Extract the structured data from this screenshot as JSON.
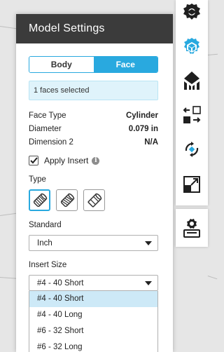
{
  "panel": {
    "title": "Model Settings",
    "segments": [
      {
        "label": "Body",
        "active": false
      },
      {
        "label": "Face",
        "active": true
      }
    ],
    "selection_text": "1 faces selected",
    "properties": [
      {
        "name": "Face Type",
        "value": "Cylinder"
      },
      {
        "name": "Diameter",
        "value": "0.079 in"
      },
      {
        "name": "Dimension 2",
        "value": "N/A"
      }
    ],
    "apply_insert": {
      "label": "Apply Insert",
      "checked": true
    },
    "type_label": "Type",
    "standard_label": "Standard",
    "standard_value": "Inch",
    "insert_size_label": "Insert Size",
    "insert_size_value": "#4 - 40 Short",
    "insert_size_options": [
      "#4 - 40 Short",
      "#4 - 40 Long",
      "#6 - 32 Short",
      "#6 - 32 Long"
    ]
  },
  "toolbar": {
    "icons": [
      "settings-gear-icon",
      "model-settings-cube-icon",
      "supports-icon",
      "arrange-icon",
      "orient-icon",
      "scale-icon"
    ],
    "secondary_icon": "print-settings-icon"
  },
  "colors": {
    "accent": "#29a9df",
    "header_bg": "#3b3b3b",
    "selection_bg": "#dff3fb",
    "highlight_bg": "#cde9f7"
  }
}
